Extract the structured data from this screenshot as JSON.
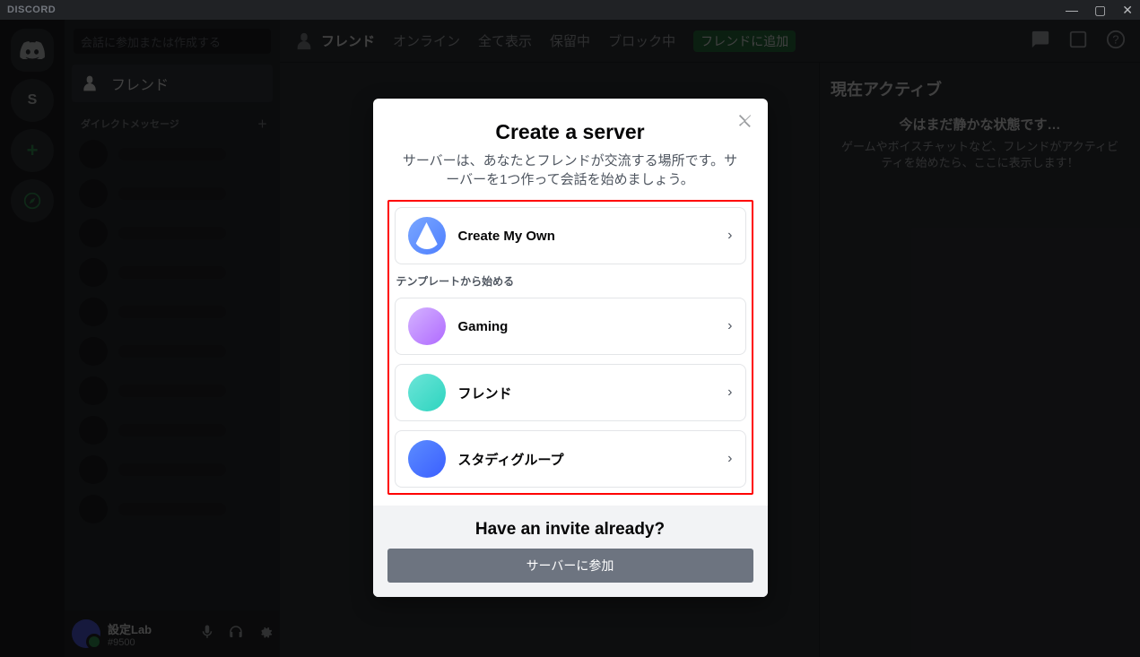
{
  "titlebar": {
    "brand": "DISCORD"
  },
  "guilds": {
    "letter": "S"
  },
  "dm": {
    "search_placeholder": "会話に参加または作成する",
    "friends_label": "フレンド",
    "dm_header": "ダイレクトメッセージ",
    "plus": "＋"
  },
  "user": {
    "name": "設定Lab",
    "tag": "#9500"
  },
  "header": {
    "title": "フレンド",
    "tabs": [
      "オンライン",
      "全て表示",
      "保留中",
      "ブロック中"
    ],
    "add": "フレンドに追加"
  },
  "activity": {
    "title": "現在アクティブ",
    "empty_title": "今はまだ静かな状態です…",
    "empty_sub": "ゲームやボイスチャットなど、フレンドがアクティビティを始めたら、ここに表示します！"
  },
  "modal": {
    "title": "Create a server",
    "subtitle": "サーバーは、あなたとフレンドが交流する場所です。サーバーを1つ作って会話を始めましょう。",
    "create_own": "Create My Own",
    "template_header": "テンプレートから始める",
    "templates": [
      {
        "label": "Gaming"
      },
      {
        "label": "フレンド"
      },
      {
        "label": "スタディグループ"
      }
    ],
    "invite_title": "Have an invite already?",
    "join_button": "サーバーに参加"
  }
}
